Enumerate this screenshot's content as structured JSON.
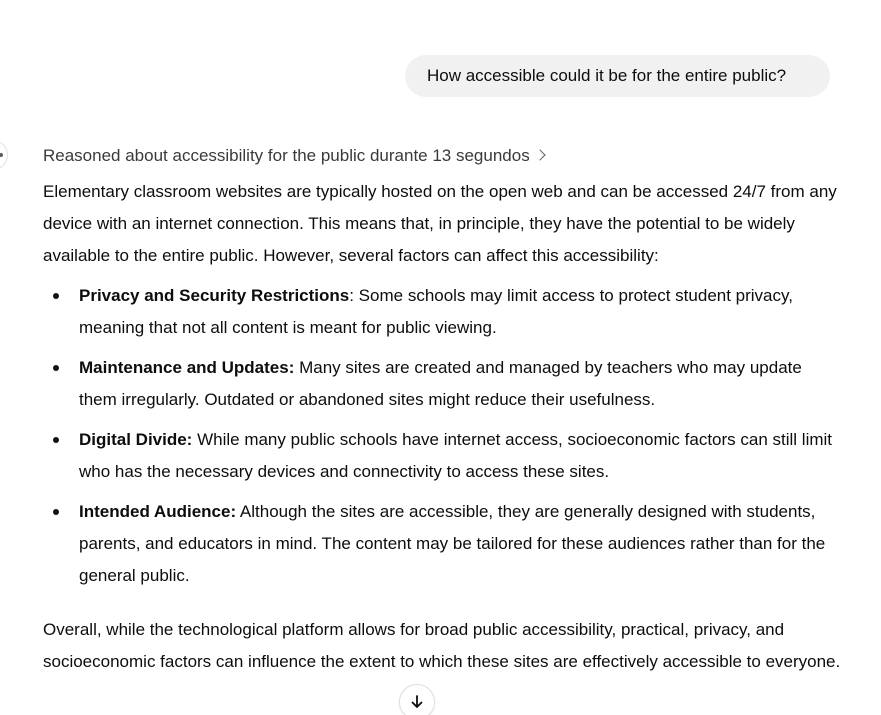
{
  "conversation": {
    "user_message": "How accessible could it be for the entire public?",
    "reasoning_summary": "Reasoned about accessibility for the public durante 13 segundos",
    "answer": {
      "intro": "Elementary classroom websites are typically hosted on the open web and can be accessed 24/7 from any device with an internet connection. This means that, in principle, they have the potential to be widely available to the entire public. However, several factors can affect this accessibility:",
      "bullets": [
        {
          "title": "Privacy and Security Restrictions",
          "text": ": Some schools may limit access to protect student privacy, meaning that not all content is meant for public viewing."
        },
        {
          "title": "Maintenance and Updates:",
          "text": " Many sites are created and managed by teachers who may update them irregularly. Outdated or abandoned sites might reduce their usefulness."
        },
        {
          "title": "Digital Divide:",
          "text": " While many public schools have internet access, socioeconomic factors can still limit who has the necessary devices and connectivity to access these sites."
        },
        {
          "title": "Intended Audience:",
          "text": " Although the sites are accessible, they are generally designed with students, parents, and educators in mind. The content may be tailored for these audiences rather than for the general public."
        }
      ],
      "closing": "Overall, while the technological platform allows for broad public accessibility, practical, privacy, and socioeconomic factors can influence the extent to which these sites are effectively accessible to everyone."
    }
  },
  "icons": {
    "reasoning_toggle": "chevron-right-icon",
    "scroll_down": "arrow-down-icon",
    "assistant_avatar": "assistant-avatar-icon"
  },
  "colors": {
    "user_bubble_bg": "#f1f1f1",
    "text": "#0d0d0d",
    "muted_text": "#3a3a3a"
  }
}
